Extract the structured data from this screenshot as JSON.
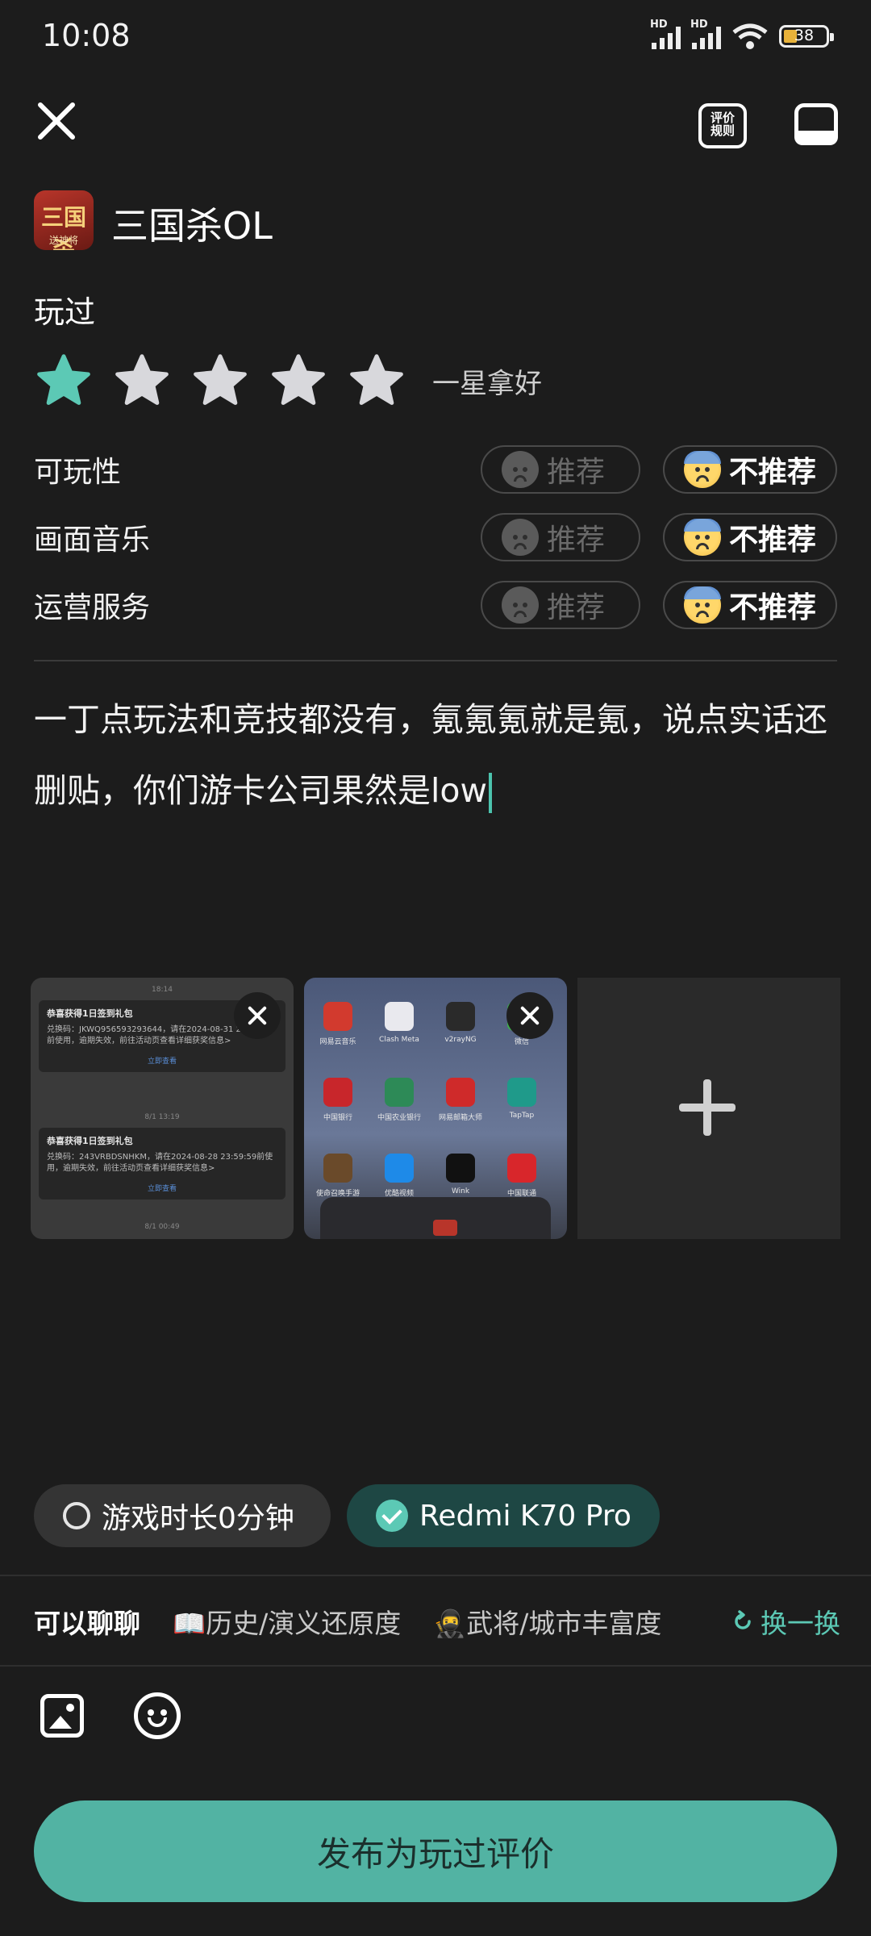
{
  "status_bar": {
    "time": "10:08",
    "battery": "38",
    "signal_label": "HD"
  },
  "header": {
    "rules_label": "评价\n规则"
  },
  "game": {
    "name": "三国杀OL",
    "logo_text": "三国杀",
    "logo_sub": "送神将"
  },
  "rating": {
    "status": "玩过",
    "stars_filled": 1,
    "stars_total": 5,
    "caption": "一星拿好",
    "star_active_color": "#5cc9b5",
    "star_inactive_color": "#d8d8dc"
  },
  "categories": [
    {
      "label": "可玩性",
      "rec": "推荐",
      "not_rec": "不推荐",
      "selected": "not_rec"
    },
    {
      "label": "画面音乐",
      "rec": "推荐",
      "not_rec": "不推荐",
      "selected": "not_rec"
    },
    {
      "label": "运营服务",
      "rec": "推荐",
      "not_rec": "不推荐",
      "selected": "not_rec"
    }
  ],
  "review_text": "一丁点玩法和竞技都没有，氪氪氪就是氪，说点实话还删贴，你们游卡公司果然是low",
  "screenshot1": {
    "time_top": "18:14",
    "card1": {
      "title": "恭喜获得1日签到礼包",
      "body": "兑换码：JKWQ956593293644，请在2024-08-31 23:59:59前使用，逾期失效，前往活动页查看详细获奖信息>",
      "link": "立即查看"
    },
    "time_mid": "8/1 13:19",
    "card2": {
      "title": "恭喜获得1日签到礼包",
      "body": "兑换码：243VRBDSNHKM，请在2024-08-28 23:59:59前使用，逾期失效，前往活动页查看详细获奖信息>",
      "link": "立即查看"
    },
    "time_bottom": "8/1 00:49"
  },
  "screenshot2": {
    "apps": [
      "网易云音乐",
      "Clash Meta",
      "v2rayNG",
      "微信",
      "中国银行",
      "中国农业银行",
      "网易邮箱大师",
      "TapTap",
      "使命召唤手游",
      "优酷视频",
      "Wink",
      "中国联通"
    ]
  },
  "chips": {
    "playtime": "游戏时长0分钟",
    "device": "Redmi  K70 Pro"
  },
  "topics": {
    "lead": "可以聊聊",
    "items": [
      "📖历史/演义还原度",
      "🥷武将/城市丰富度"
    ],
    "swap": "换一换"
  },
  "submit_label": "发布为玩过评价",
  "colors": {
    "accent": "#5cc9b5",
    "submit_bg": "#52b3a3",
    "bg": "#1c1c1c"
  }
}
